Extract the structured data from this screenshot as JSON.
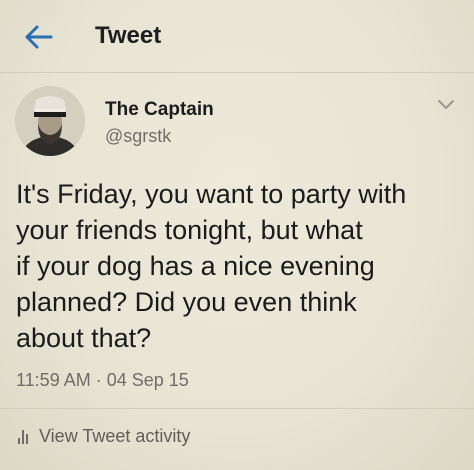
{
  "header": {
    "title": "Tweet",
    "back_icon": "arrow-left-icon",
    "accent": "#2a6fb3"
  },
  "author": {
    "name": "The Captain",
    "handle": "@sgrstk",
    "avatar": "profile-photo"
  },
  "tweet": {
    "lines": [
      "It's Friday, you want to party with",
      "your friends tonight, but what",
      "if your dog has a nice evening",
      "planned? Did you even think",
      "about that?"
    ],
    "time": "11:59 AM",
    "separator": "·",
    "date": "04 Sep 15"
  },
  "actions": {
    "activity_label": "View Tweet activity",
    "activity_icon": "bar-chart-icon"
  }
}
